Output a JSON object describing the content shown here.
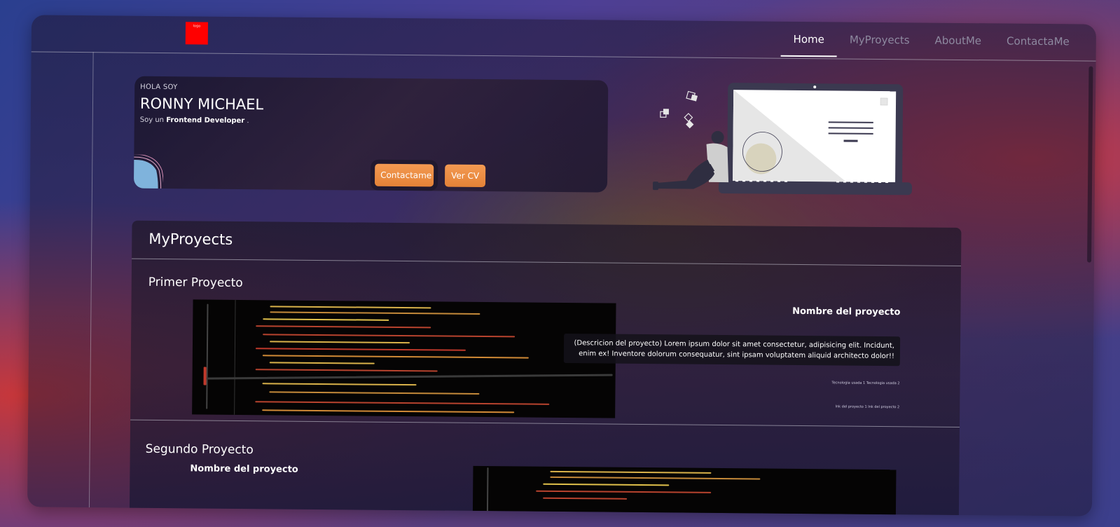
{
  "header": {
    "logo_text": "logo",
    "nav": [
      {
        "label": "Home",
        "active": true
      },
      {
        "label": "MyProyects",
        "active": false
      },
      {
        "label": "AboutMe",
        "active": false
      },
      {
        "label": "ContactaMe",
        "active": false
      }
    ]
  },
  "hero": {
    "greeting": "HOLA SOY",
    "name": "RONNY MICHAEL",
    "role_prefix": "Soy un",
    "role": "Frontend Developer",
    "role_suffix": ".",
    "buttons": {
      "contact": "Contactame",
      "cv": "Ver CV"
    }
  },
  "projects": {
    "title": "MyProyects",
    "items": [
      {
        "title": "Primer Proyecto",
        "name": "Nombre del proyecto",
        "description": "(Descricion del proyecto) Lorem ipsum dolor sit amet consectetur, adipisicing elit. Incidunt, enim ex! Inventore dolorum consequatur, sint ipsam voluptatem aliquid architecto dolor!!",
        "tech": "Tecnologia usada 1 Tecnologia usada 2",
        "links": "lnk del proyecto 1 lnk del proyecto 2"
      },
      {
        "title": "Segundo Proyecto",
        "name": "Nombre del proyecto"
      }
    ]
  },
  "colors": {
    "accent_button": "#f0914a",
    "logo": "#ff0000"
  }
}
